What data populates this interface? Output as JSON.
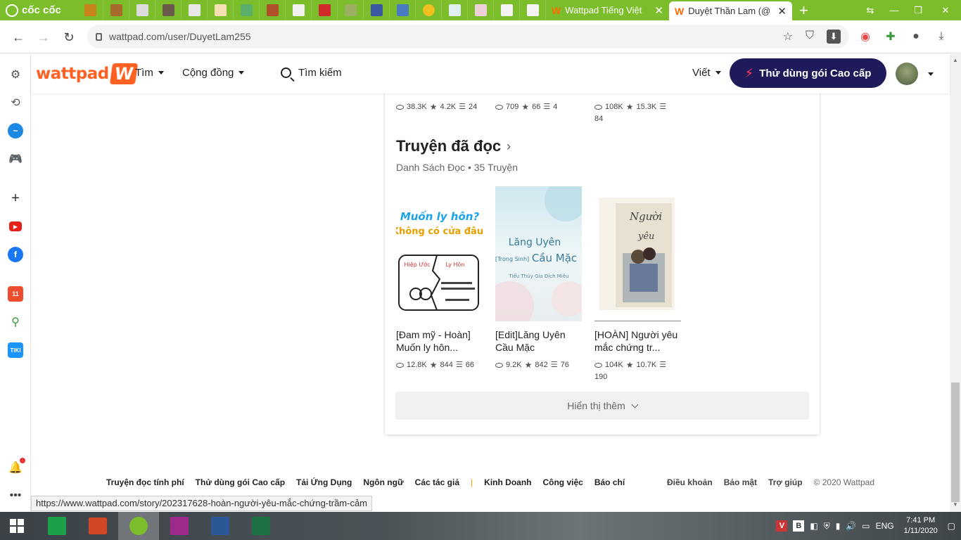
{
  "browser": {
    "brand": "cốc cốc",
    "tabs": [
      {
        "label": "Wattpad Tiếng Việt",
        "active": false
      },
      {
        "label": "Duyệt Thần Lam (@",
        "active": true
      }
    ],
    "url": "wattpad.com/user/DuyetLam255",
    "status_url": "https://www.wattpad.com/story/202317628-hoàn-người-yêu-mắc-chứng-trầm-cảm"
  },
  "wattpad": {
    "logo": "wattpad",
    "nav": {
      "browse": "Tìm",
      "community": "Cộng đồng",
      "search": "Tìm kiếm",
      "write": "Viết",
      "premium": "Thử dùng gói Cao cấp"
    }
  },
  "top_row_stats": [
    {
      "reads": "38.3K",
      "votes": "4.2K",
      "parts": "24"
    },
    {
      "reads": "709",
      "votes": "66",
      "parts": "4"
    },
    {
      "reads": "108K",
      "votes": "15.3K",
      "parts": "84"
    }
  ],
  "reading_list": {
    "title": "Truyện đã đọc",
    "subtitle": "Danh Sách Đọc • 35 Truyện",
    "books": [
      {
        "title": "[Đam mỹ - Hoàn] Muốn ly hôn...",
        "reads": "12.8K",
        "votes": "844",
        "parts": "66",
        "cover_text": [
          "Muốn ly hôn?",
          "Không có cửa đâu!",
          "Hiệp Ước",
          "Ly Hôn"
        ]
      },
      {
        "title": "[Edit]Lăng Uyên Cầu Mặc",
        "reads": "9.2K",
        "votes": "842",
        "parts": "76",
        "cover_text": [
          "Lăng Uyên",
          "[Trọng Sinh]",
          "Cầu Mặc",
          "Tiểu Thúy Gia Đích Miêu"
        ]
      },
      {
        "title": "[HOÀN] Người yêu mắc chứng tr...",
        "reads": "104K",
        "votes": "10.7K",
        "parts": "190",
        "cover_text": [
          "Người",
          "yêu"
        ]
      }
    ],
    "show_more": "Hiển thị thêm"
  },
  "footer": {
    "left": [
      "Truyện đọc tính phí",
      "Thử dùng gói Cao cấp",
      "Tải Ứng Dụng",
      "Ngôn ngữ",
      "Các tác giả",
      "Kinh Doanh",
      "Công việc",
      "Báo chí"
    ],
    "separator": "|",
    "right": [
      "Điều khoản",
      "Bảo mật",
      "Trợ giúp"
    ],
    "copyright": "© 2020 Wattpad"
  },
  "taskbar": {
    "lang": "ENG",
    "time": "7:41 PM",
    "date": "1/11/2020"
  },
  "colors": {
    "browser_green": "#7cbd2b",
    "wattpad_orange": "#ff6122",
    "premium_bg": "#1f1a5a"
  }
}
